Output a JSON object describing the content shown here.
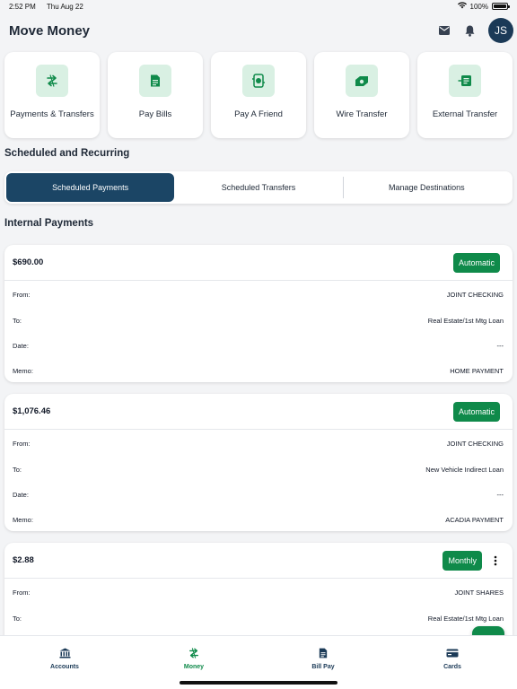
{
  "status_bar": {
    "time": "2:52 PM",
    "date": "Thu Aug 22",
    "battery": "100%"
  },
  "header": {
    "title": "Move Money",
    "avatar_initials": "JS"
  },
  "quick_actions": [
    {
      "label": "Payments & Transfers",
      "icon": "transfer-arrows-icon"
    },
    {
      "label": "Pay Bills",
      "icon": "bill-icon"
    },
    {
      "label": "Pay A Friend",
      "icon": "pay-friend-icon"
    },
    {
      "label": "Wire Transfer",
      "icon": "wire-transfer-icon"
    },
    {
      "label": "External Transfer",
      "icon": "external-transfer-icon"
    }
  ],
  "scheduled": {
    "title": "Scheduled and Recurring",
    "tabs": [
      "Scheduled Payments",
      "Scheduled Transfers",
      "Manage Destinations"
    ],
    "active_tab": "Scheduled Payments"
  },
  "internal": {
    "title": "Internal Payments",
    "field_labels": {
      "from": "From:",
      "to": "To:",
      "date": "Date:",
      "memo": "Memo:"
    },
    "payments": [
      {
        "amount": "$690.00",
        "badge": "Automatic",
        "from": "JOINT CHECKING",
        "to": "Real Estate/1st Mtg Loan",
        "date": "---",
        "memo": "HOME PAYMENT"
      },
      {
        "amount": "$1,076.46",
        "badge": "Automatic",
        "from": "JOINT CHECKING",
        "to": "New Vehicle Indirect Loan",
        "date": "---",
        "memo": "ACADIA PAYMENT"
      },
      {
        "amount": "$2.88",
        "badge": "Monthly",
        "from": "JOINT SHARES",
        "to": "Real Estate/1st Mtg Loan"
      }
    ]
  },
  "bottom_nav": [
    {
      "label": "Accounts",
      "icon": "bank-icon"
    },
    {
      "label": "Money",
      "icon": "transfer-arrows-icon"
    },
    {
      "label": "Bill Pay",
      "icon": "bill-icon"
    },
    {
      "label": "Cards",
      "icon": "card-icon"
    }
  ],
  "colors": {
    "primary": "#1b4565",
    "accent_green": "#0f8a4a",
    "icon_bg": "#d9f0e3",
    "background": "#f3f4f6"
  }
}
